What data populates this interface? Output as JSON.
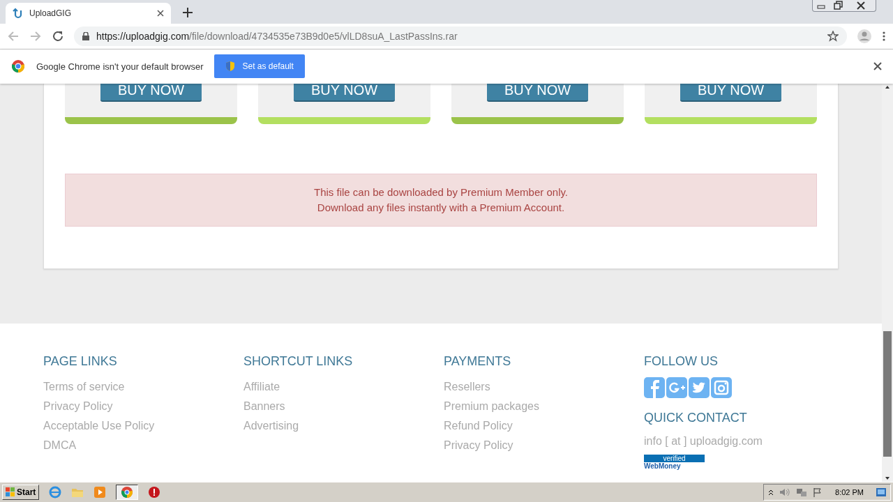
{
  "browser": {
    "tab_title": "UploadGIG",
    "url_host": "https://uploadgig.com",
    "url_path": "/file/download/4734535e73B9d0e5/vlLD8suA_LastPassIns.rar"
  },
  "infobar": {
    "message": "Google Chrome isn't your default browser",
    "button": "Set as default"
  },
  "plans": [
    {
      "button": "BUY NOW",
      "color": "#9bc34a"
    },
    {
      "button": "BUY NOW",
      "color": "#b3df60"
    },
    {
      "button": "BUY NOW",
      "color": "#9bc34a"
    },
    {
      "button": "BUY NOW",
      "color": "#b3df60"
    }
  ],
  "alert": {
    "lines": [
      "This file can be downloaded by Premium Member only.",
      "Download any files instantly with a Premium Account."
    ]
  },
  "footer": {
    "sections": [
      {
        "title": "PAGE LINKS",
        "links": [
          "Terms of service",
          "Privacy Policy",
          "Acceptable Use Policy",
          "DMCA"
        ]
      },
      {
        "title": "SHORTCUT LINKS",
        "links": [
          "Affiliate",
          "Banners",
          "Advertising"
        ]
      },
      {
        "title": "PAYMENTS",
        "links": [
          "Resellers",
          "Premium packages",
          "Refund Policy",
          "Privacy Policy"
        ]
      }
    ],
    "follow_title": "FOLLOW US",
    "social": [
      {
        "kind": "facebook"
      },
      {
        "kind": "googleplus"
      },
      {
        "kind": "twitter"
      },
      {
        "kind": "instagram"
      }
    ],
    "contact_title": "QUICK CONTACT",
    "email": "info [ at ] uploadgig.com",
    "badge_top": "verified",
    "badge_bottom": "WebMoney"
  },
  "taskbar": {
    "start": "Start",
    "clock": "8:02 PM"
  }
}
